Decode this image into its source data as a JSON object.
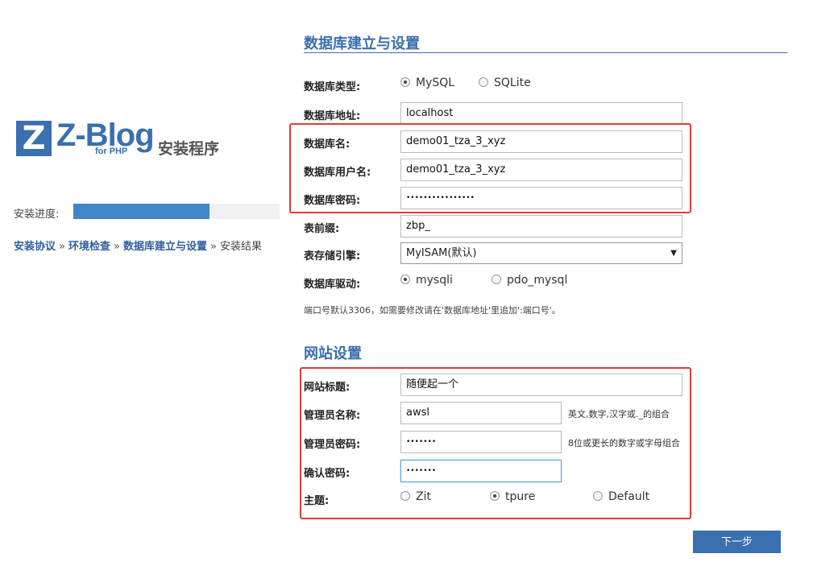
{
  "logo": {
    "mark": "Z",
    "brand": "Z-Blog",
    "sub": "for PHP",
    "title": "安装程序"
  },
  "progress": {
    "label": "安装进度:",
    "fraction": 0.66
  },
  "breadcrumb": {
    "steps": [
      "安装协议",
      "环境检查",
      "数据库建立与设置",
      "安装结果"
    ],
    "separator": "»"
  },
  "db_section": {
    "title": "数据库建立与设置",
    "type_label": "数据库类型:",
    "type_options": [
      "MySQL",
      "SQLite"
    ],
    "type_selected": "MySQL",
    "host_label": "数据库地址:",
    "host_value": "localhost",
    "name_label": "数据库名:",
    "name_value": "demo01_tza_3_xyz",
    "user_label": "数据库用户名:",
    "user_value": "demo01_tza_3_xyz",
    "pass_label": "数据库密码:",
    "pass_value": "••••••••••••••••",
    "prefix_label": "表前缀:",
    "prefix_value": "zbp_",
    "engine_label": "表存储引擎:",
    "engine_value": "MyISAM(默认)",
    "driver_label": "数据库驱动:",
    "driver_options": [
      "mysqli",
      "pdo_mysql"
    ],
    "driver_selected": "mysqli",
    "port_note": "端口号默认3306，如需要修改请在'数据库地址'里追加':端口号'。"
  },
  "site_section": {
    "title": "网站设置",
    "site_title_label": "网站标题:",
    "site_title_value": "随便起一个",
    "admin_name_label": "管理员名称:",
    "admin_name_value": "awsl",
    "admin_name_hint": "英文,数字,汉字或._的组合",
    "admin_pass_label": "管理员密码:",
    "admin_pass_value": "•••••••",
    "admin_pass_hint": "8位或更长的数字或字母组合",
    "confirm_label": "确认密码:",
    "confirm_value": "•••••••",
    "theme_label": "主题:",
    "theme_options": [
      "Zit",
      "tpure",
      "Default"
    ],
    "theme_selected": "tpure"
  },
  "next_button": "下一步",
  "colors": {
    "accent": "#3a6fb0",
    "progress": "#3f86c8",
    "highlight_box": "#e33a3a"
  }
}
